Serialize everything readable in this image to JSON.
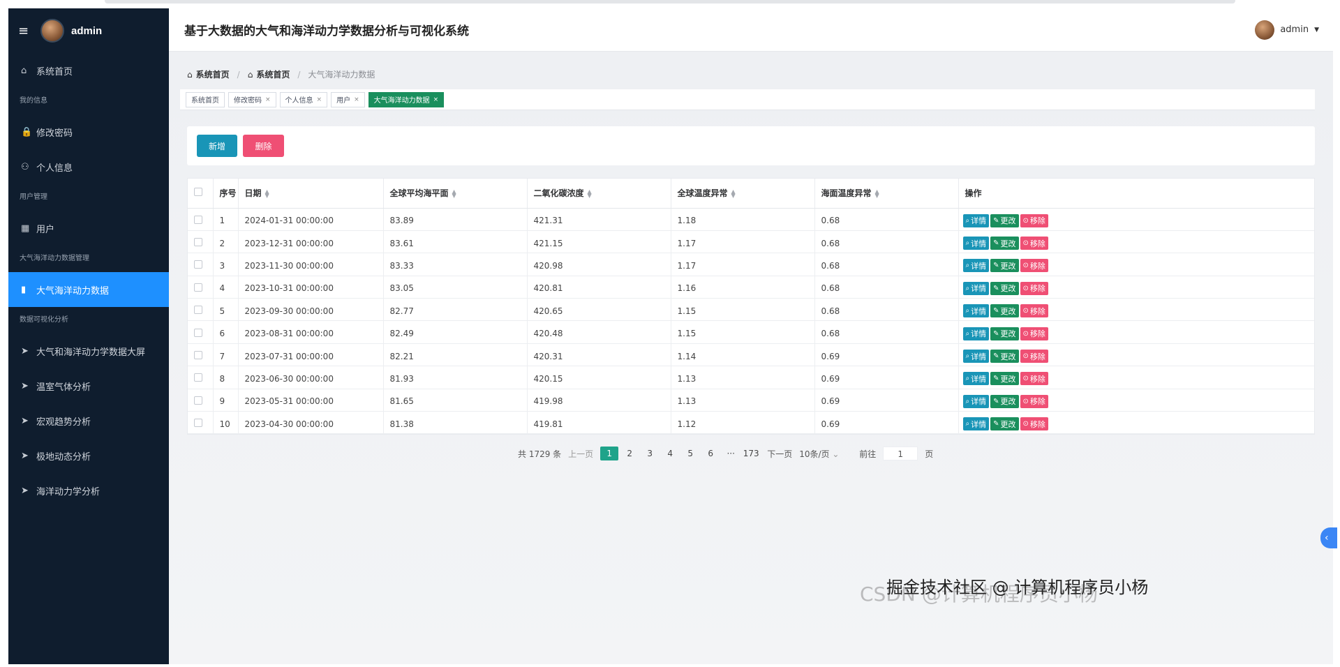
{
  "sidebar": {
    "user": "admin",
    "items": [
      {
        "type": "item",
        "label": "系统首页",
        "icon": "home-icon",
        "glyph": "⌂"
      },
      {
        "type": "group",
        "label": "我的信息"
      },
      {
        "type": "item",
        "label": "修改密码",
        "icon": "lock-icon",
        "glyph": "🔒"
      },
      {
        "type": "item",
        "label": "个人信息",
        "icon": "person-icon",
        "glyph": "⚇"
      },
      {
        "type": "group",
        "label": "用户管理"
      },
      {
        "type": "item",
        "label": "用户",
        "icon": "grid-icon",
        "glyph": "▦"
      },
      {
        "type": "group",
        "label": "大气海洋动力数据管理"
      },
      {
        "type": "item",
        "label": "大气海洋动力数据",
        "icon": "bar-chart-icon",
        "glyph": "▮",
        "active": true
      },
      {
        "type": "group",
        "label": "数据可视化分析"
      },
      {
        "type": "item",
        "label": "大气和海洋动力学数据大屏",
        "icon": "send-icon",
        "glyph": "➤"
      },
      {
        "type": "item",
        "label": "温室气体分析",
        "icon": "send-icon",
        "glyph": "➤"
      },
      {
        "type": "item",
        "label": "宏观趋势分析",
        "icon": "send-icon",
        "glyph": "➤"
      },
      {
        "type": "item",
        "label": "极地动态分析",
        "icon": "send-icon",
        "glyph": "➤"
      },
      {
        "type": "item",
        "label": "海洋动力学分析",
        "icon": "send-icon",
        "glyph": "➤"
      }
    ]
  },
  "header": {
    "title": "基于大数据的大气和海洋动力学数据分析与可视化系统",
    "user": "admin"
  },
  "breadcrumb": {
    "home1": "系统首页",
    "home2": "系统首页",
    "current": "大气海洋动力数据"
  },
  "tags": [
    {
      "label": "系统首页",
      "closable": false
    },
    {
      "label": "修改密码",
      "closable": true
    },
    {
      "label": "个人信息",
      "closable": true
    },
    {
      "label": "用户",
      "closable": true
    },
    {
      "label": "大气海洋动力数据",
      "closable": true,
      "active": true
    }
  ],
  "toolbar": {
    "add_label": "新增",
    "delete_label": "删除"
  },
  "table": {
    "headers": {
      "index": "序号",
      "date": "日期",
      "sea_level": "全球平均海平面",
      "co2": "二氧化碳浓度",
      "temp": "全球温度异常",
      "sst": "海面温度异常",
      "ops": "操作"
    },
    "actions": {
      "detail": "详情",
      "edit": "更改",
      "remove": "移除"
    },
    "rows": [
      [
        "1",
        "2024-01-31 00:00:00",
        "83.89",
        "421.31",
        "1.18",
        "0.68"
      ],
      [
        "2",
        "2023-12-31 00:00:00",
        "83.61",
        "421.15",
        "1.17",
        "0.68"
      ],
      [
        "3",
        "2023-11-30 00:00:00",
        "83.33",
        "420.98",
        "1.17",
        "0.68"
      ],
      [
        "4",
        "2023-10-31 00:00:00",
        "83.05",
        "420.81",
        "1.16",
        "0.68"
      ],
      [
        "5",
        "2023-09-30 00:00:00",
        "82.77",
        "420.65",
        "1.15",
        "0.68"
      ],
      [
        "6",
        "2023-08-31 00:00:00",
        "82.49",
        "420.48",
        "1.15",
        "0.68"
      ],
      [
        "7",
        "2023-07-31 00:00:00",
        "82.21",
        "420.31",
        "1.14",
        "0.69"
      ],
      [
        "8",
        "2023-06-30 00:00:00",
        "81.93",
        "420.15",
        "1.13",
        "0.69"
      ],
      [
        "9",
        "2023-05-31 00:00:00",
        "81.65",
        "419.98",
        "1.13",
        "0.69"
      ],
      [
        "10",
        "2023-04-30 00:00:00",
        "81.38",
        "419.81",
        "1.12",
        "0.69"
      ]
    ]
  },
  "pagination": {
    "total": "共 1729 条",
    "prev": "上一页",
    "pages": [
      "1",
      "2",
      "3",
      "4",
      "5",
      "6",
      "···",
      "173"
    ],
    "current": "1",
    "next": "下一页",
    "size": "10条/页",
    "goto_label": "前往",
    "goto_value": "1",
    "goto_suffix": "页"
  },
  "watermark": {
    "front": "掘金技术社区 @ 计算机程序员小杨",
    "back": "CSDN @计算机程序员小杨"
  },
  "colors": {
    "sidebar": "#0f1d2e",
    "active": "#1e90ff",
    "detail": "#1995b7",
    "edit": "#1a8f5d",
    "remove": "#ef4f74",
    "page_active": "#1fa38a"
  }
}
